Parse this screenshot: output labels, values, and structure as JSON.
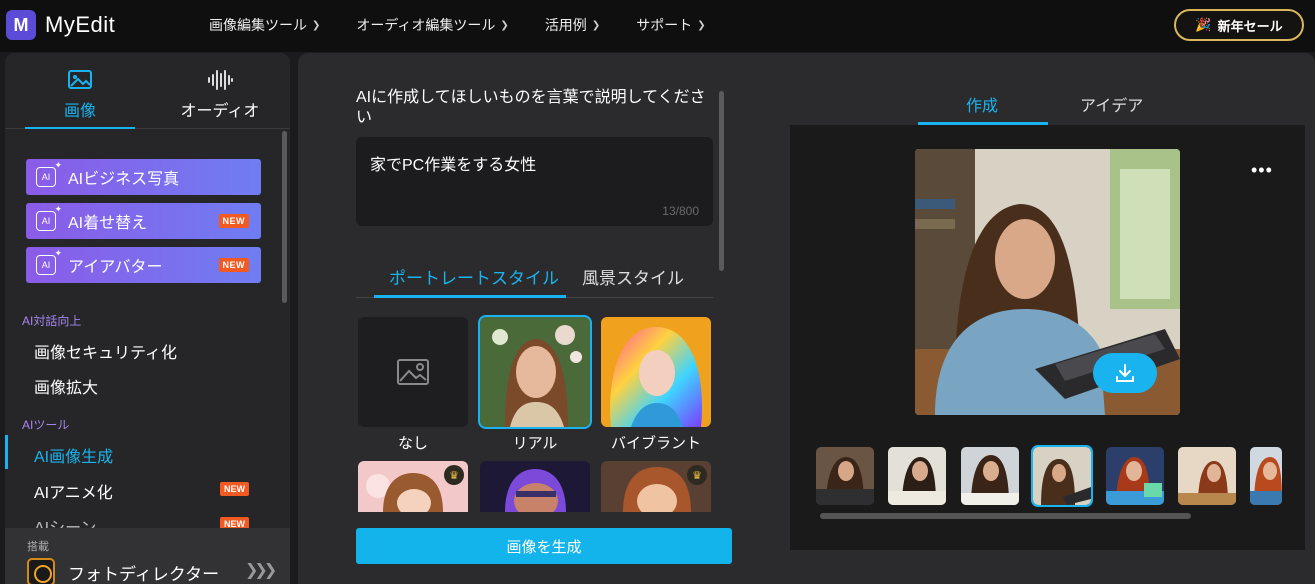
{
  "app": {
    "logo_mark": "M",
    "name": "MyEdit"
  },
  "nav": {
    "items": [
      {
        "label": "画像編集ツール"
      },
      {
        "label": "オーディオ編集ツール"
      },
      {
        "label": "活用例"
      },
      {
        "label": "サポート"
      }
    ],
    "sale_label": "新年セール"
  },
  "sidebar": {
    "tabs": [
      {
        "label": "画像",
        "icon": "image-icon"
      },
      {
        "label": "オーディオ",
        "icon": "waveform-icon"
      }
    ],
    "ai_buttons": [
      {
        "label": "AIビジネス写真",
        "badge": ""
      },
      {
        "label": "AI着せ替え",
        "badge": "NEW"
      },
      {
        "label": "アイアバター",
        "badge": "NEW"
      }
    ],
    "section_dialog": "AI対話向上",
    "dialog_items": [
      "画像セキュリティ化",
      "画像拡大"
    ],
    "section_tools": "AIツール",
    "tool_items": [
      {
        "label": "AI画像生成",
        "badge": ""
      },
      {
        "label": "AIアニメ化",
        "badge": "NEW"
      },
      {
        "label": "AIシーン",
        "badge": "NEW"
      }
    ],
    "bundled_tag": "搭載",
    "bundled_name": "フォトディレクター"
  },
  "prompt": {
    "label": "AIに作成してほしいものを言葉で説明してください",
    "value": "家でPC作業をする女性",
    "count": "13/800"
  },
  "styles": {
    "tabs": [
      "ポートレートスタイル",
      "風景スタイル"
    ],
    "cards": [
      {
        "label": "なし"
      },
      {
        "label": "リアル"
      },
      {
        "label": "バイブラント"
      }
    ]
  },
  "generate_label": "画像を生成",
  "result": {
    "tabs": [
      "作成",
      "アイデア"
    ],
    "menu": "•••"
  },
  "colors": {
    "accent": "#19b4ef",
    "new_badge": "#f25a22",
    "sale_border": "#d9b65c"
  }
}
